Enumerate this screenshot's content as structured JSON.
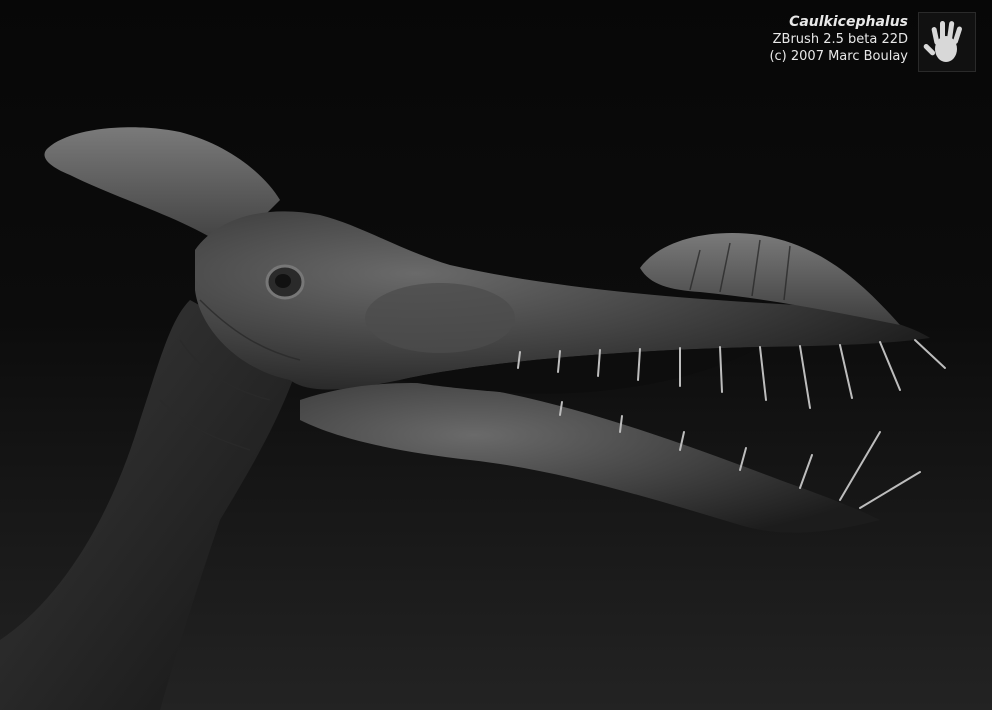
{
  "caption": {
    "title": "Caulkicephalus",
    "software": "ZBrush 2.5 beta 22D",
    "copyright": "(c) 2007 Marc Boulay"
  },
  "logo": {
    "icon": "hand-print-icon"
  },
  "render": {
    "subject": "pterosaur-head-sculpt",
    "background_color": "#0a0a0a"
  }
}
